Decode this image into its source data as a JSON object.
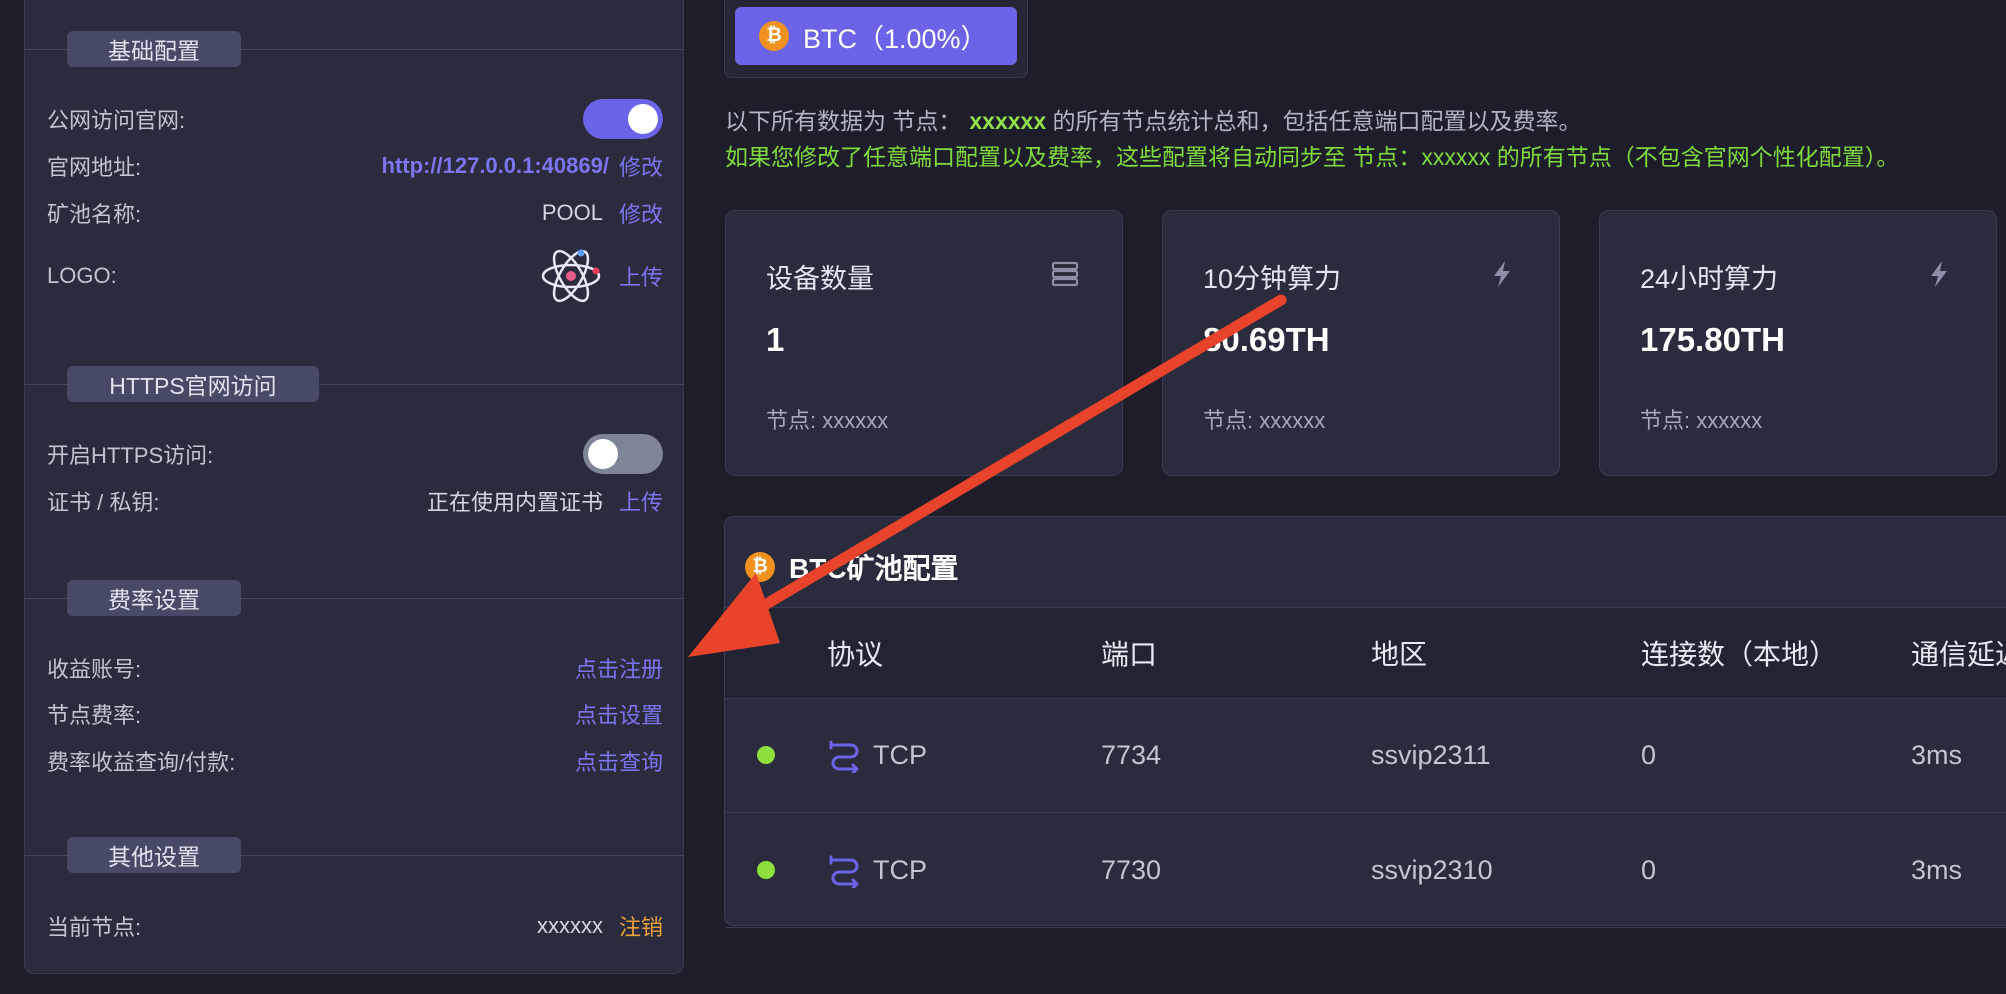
{
  "sidebar": {
    "basic": {
      "title": "基础配置",
      "public_access": {
        "label": "公网访问官网:",
        "enabled": true
      },
      "site_address": {
        "label": "官网地址:",
        "value": "http://127.0.0.1:40869/",
        "action": "修改"
      },
      "pool_name": {
        "label": "矿池名称:",
        "value": "POOL",
        "action": "修改"
      },
      "logo": {
        "label": "LOGO:",
        "icon": "atom-logo-icon",
        "action": "上传"
      }
    },
    "https": {
      "title": "HTTPS官网访问",
      "enable_https": {
        "label": "开启HTTPS访问:",
        "enabled": false
      },
      "certificate": {
        "label": "证书 / 私钥:",
        "value": "正在使用内置证书",
        "action": "上传"
      }
    },
    "fee": {
      "title": "费率设置",
      "account": {
        "label": "收益账号:",
        "action": "点击注册"
      },
      "node_fee": {
        "label": "节点费率:",
        "action": "点击设置"
      },
      "fee_query": {
        "label": "费率收益查询/付款:",
        "action": "点击查询"
      }
    },
    "other": {
      "title": "其他设置",
      "current_node": {
        "label": "当前节点:",
        "value": "xxxxxx",
        "action": "注销"
      }
    }
  },
  "coin_tab": {
    "label": "BTC（1.00%）",
    "icon": "btc-coin-icon"
  },
  "info": {
    "line1_prefix": "以下所有数据为 节点：",
    "line1_node": "xxxxxx",
    "line1_suffix": " 的所有节点统计总和，包括任意端口配置以及费率。",
    "line2": "如果您修改了任意端口配置以及费率，这些配置将自动同步至 节点：xxxxxx 的所有节点（不包含官网个性化配置）。"
  },
  "stats": [
    {
      "title": "设备数量",
      "value": "1",
      "sub": "节点: xxxxxx",
      "icon": "server-icon"
    },
    {
      "title": "10分钟算力",
      "value": "80.69TH",
      "sub": "节点: xxxxxx",
      "icon": "lightning-icon"
    },
    {
      "title": "24小时算力",
      "value": "175.80TH",
      "sub": "节点: xxxxxx",
      "icon": "lightning-icon"
    }
  ],
  "pool": {
    "title": "BTC矿池配置",
    "columns": [
      "协议",
      "端口",
      "地区",
      "连接数（本地）",
      "通信延迟"
    ],
    "rows": [
      {
        "status": "online",
        "protocol": "TCP",
        "port": "7734",
        "region": "ssvip2311",
        "connections": "0",
        "latency": "3ms"
      },
      {
        "status": "online",
        "protocol": "TCP",
        "port": "7730",
        "region": "ssvip2310",
        "connections": "0",
        "latency": "3ms"
      }
    ]
  },
  "colors": {
    "accent": "#6b63e8",
    "green_text": "#7fda3b",
    "orange_link": "#e9a23b",
    "annotation_arrow": "#e8432b"
  }
}
